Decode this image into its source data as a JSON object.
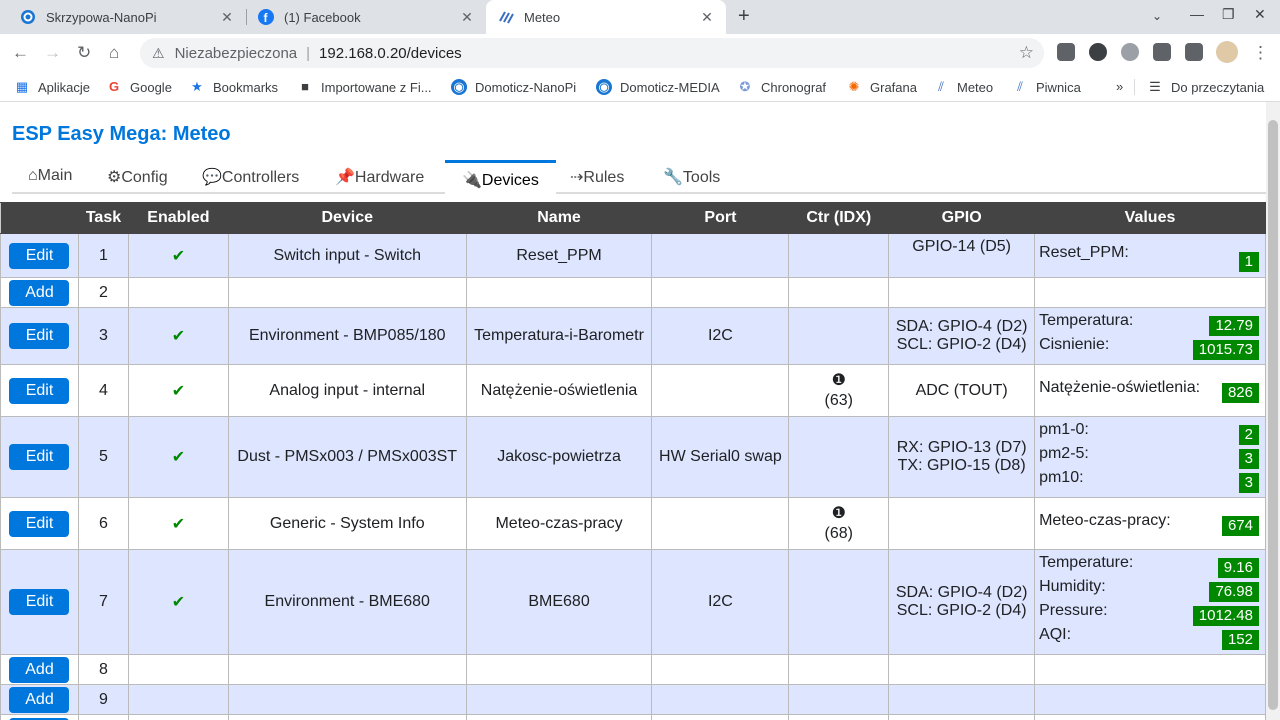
{
  "browser": {
    "tabs": [
      {
        "title": "Skrzypowa-NanoPi"
      },
      {
        "title": "(1) Facebook"
      },
      {
        "title": "Meteo"
      }
    ],
    "address": {
      "security_label": "Niezabezpieczona",
      "url": "192.168.0.20/devices"
    },
    "bookmarks": [
      {
        "label": "Aplikacje"
      },
      {
        "label": "Google"
      },
      {
        "label": "Bookmarks"
      },
      {
        "label": "Importowane z Fi..."
      },
      {
        "label": "Domoticz-NanoPi"
      },
      {
        "label": "Domoticz-MEDIA"
      },
      {
        "label": "Chronograf"
      },
      {
        "label": "Grafana"
      },
      {
        "label": "Meteo"
      },
      {
        "label": "Piwnica"
      }
    ],
    "more_bookmarks": "»",
    "reading_list": "Do przeczytania"
  },
  "page": {
    "title": "ESP Easy Mega: Meteo",
    "menu": [
      {
        "label": "⌂Main"
      },
      {
        "label": "⚙Config"
      },
      {
        "label": "💬Controllers"
      },
      {
        "label": "📌Hardware"
      },
      {
        "label": "🔌Devices"
      },
      {
        "label": "⇢Rules"
      },
      {
        "label": "🔧Tools"
      }
    ],
    "table": {
      "headers": [
        "",
        "Task",
        "Enabled",
        "Device",
        "Name",
        "Port",
        "Ctr (IDX)",
        "GPIO",
        "Values"
      ],
      "rows": [
        {
          "action": "Edit",
          "task": "1",
          "enabled": "✔",
          "device": "Switch input - Switch",
          "name": "Reset_PPM",
          "port": "",
          "ctr": "",
          "idx": "",
          "gpio1": "GPIO-14 (D5)",
          "gpio2": "",
          "values": [
            {
              "label": "Reset_PPM:",
              "value": "1"
            }
          ]
        },
        {
          "action": "Add",
          "task": "2",
          "enabled": "",
          "device": "",
          "name": "",
          "port": "",
          "ctr": "",
          "idx": "",
          "gpio1": "",
          "gpio2": "",
          "values": []
        },
        {
          "action": "Edit",
          "task": "3",
          "enabled": "✔",
          "device": "Environment - BMP085/180",
          "name": "Temperatura-i-Barometr",
          "port": "I2C",
          "ctr": "",
          "idx": "",
          "gpio1": "SDA: GPIO-4 (D2)",
          "gpio2": "SCL: GPIO-2 (D4)",
          "values": [
            {
              "label": "Temperatura:",
              "value": "12.79"
            },
            {
              "label": "Cisnienie:",
              "value": "1015.73"
            }
          ]
        },
        {
          "action": "Edit",
          "task": "4",
          "enabled": "✔",
          "device": "Analog input - internal",
          "name": "Natężenie-oświetlenia",
          "port": "",
          "ctr": "❶",
          "idx": "(63)",
          "gpio1": "ADC (TOUT)",
          "gpio2": "",
          "values": [
            {
              "label": "Natężenie-oświetlenia:",
              "value": "826"
            }
          ]
        },
        {
          "action": "Edit",
          "task": "5",
          "enabled": "✔",
          "device": "Dust - PMSx003 / PMSx003ST",
          "name": "Jakosc-powietrza",
          "port": "HW Serial0 swap",
          "ctr": "",
          "idx": "",
          "gpio1": "RX: GPIO-13 (D7)",
          "gpio2": "TX: GPIO-15 (D8)",
          "values": [
            {
              "label": "pm1-0:",
              "value": "2"
            },
            {
              "label": "pm2-5:",
              "value": "3"
            },
            {
              "label": "pm10:",
              "value": "3"
            }
          ]
        },
        {
          "action": "Edit",
          "task": "6",
          "enabled": "✔",
          "device": "Generic - System Info",
          "name": "Meteo-czas-pracy",
          "port": "",
          "ctr": "❶",
          "idx": "(68)",
          "gpio1": "",
          "gpio2": "",
          "values": [
            {
              "label": "Meteo-czas-pracy:",
              "value": "674"
            }
          ]
        },
        {
          "action": "Edit",
          "task": "7",
          "enabled": "✔",
          "device": "Environment - BME680",
          "name": "BME680",
          "port": "I2C",
          "ctr": "",
          "idx": "",
          "gpio1": "SDA: GPIO-4 (D2)",
          "gpio2": "SCL: GPIO-2 (D4)",
          "values": [
            {
              "label": "Temperature:",
              "value": "9.16"
            },
            {
              "label": "Humidity:",
              "value": "76.98"
            },
            {
              "label": "Pressure:",
              "value": "1012.48"
            },
            {
              "label": "AQI:",
              "value": "152"
            }
          ]
        },
        {
          "action": "Add",
          "task": "8",
          "enabled": "",
          "device": "",
          "name": "",
          "port": "",
          "ctr": "",
          "idx": "",
          "gpio1": "",
          "gpio2": "",
          "values": []
        },
        {
          "action": "Add",
          "task": "9",
          "enabled": "",
          "device": "",
          "name": "",
          "port": "",
          "ctr": "",
          "idx": "",
          "gpio1": "",
          "gpio2": "",
          "values": []
        },
        {
          "action": "Add",
          "task": "",
          "enabled": "",
          "device": "",
          "name": "",
          "port": "",
          "ctr": "",
          "idx": "",
          "gpio1": "",
          "gpio2": "",
          "values": []
        }
      ]
    }
  },
  "colors": {
    "accent": "#0077dd",
    "value_badge": "#008800",
    "row_alt": "#dde5ff",
    "header": "#444444"
  }
}
